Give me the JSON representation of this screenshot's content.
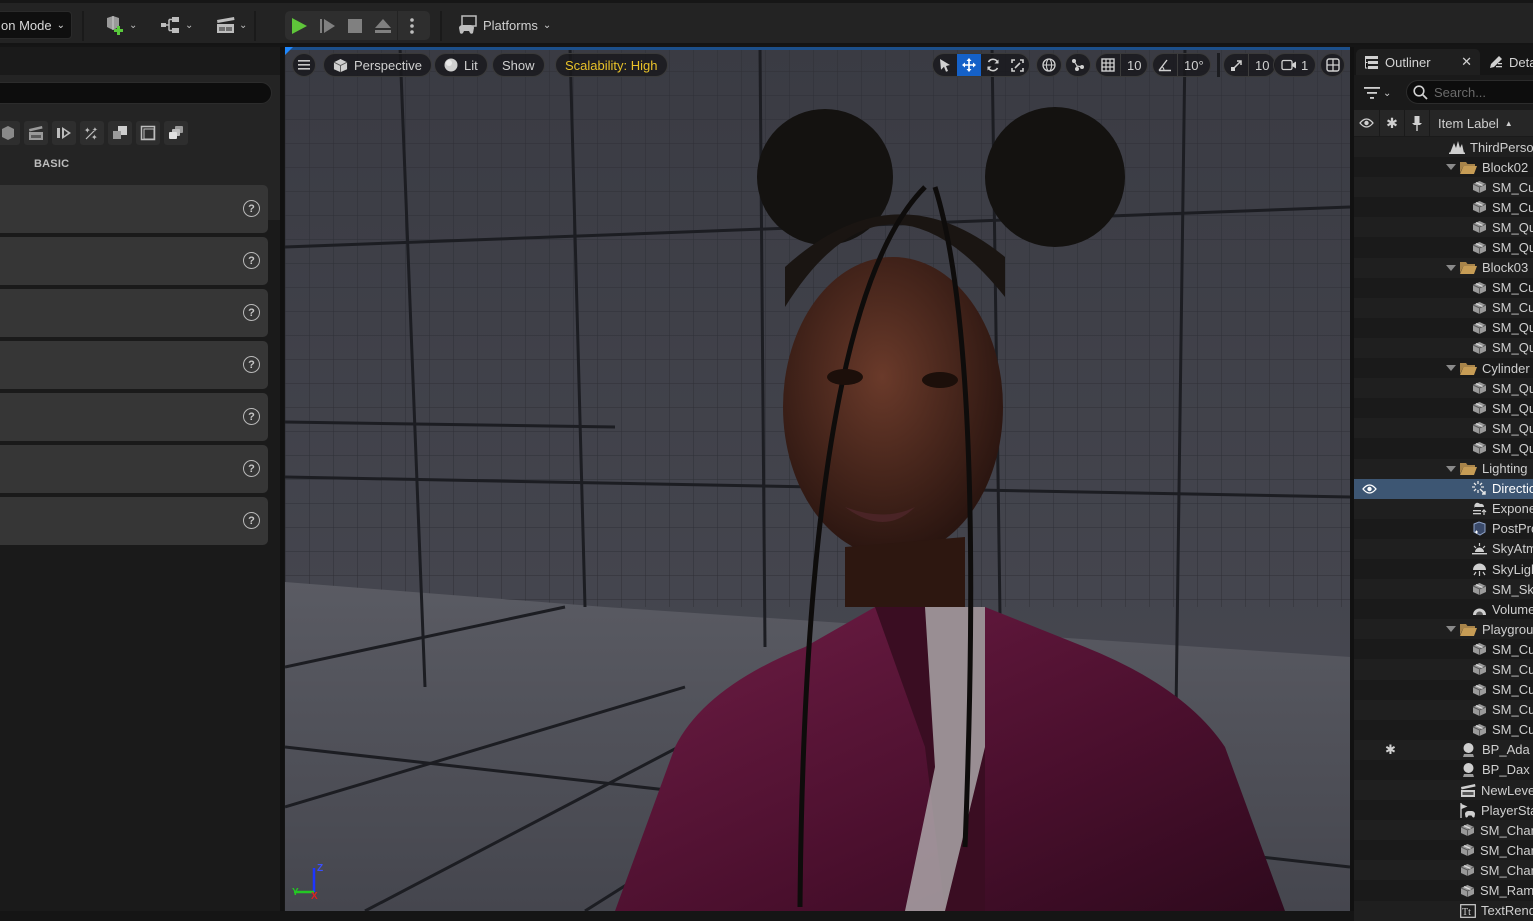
{
  "toolbar": {
    "mode_label": "on Mode",
    "icons": [
      "add-actor-icon",
      "blueprint-icon",
      "cinematics-icon"
    ],
    "play_controls": [
      "play-icon",
      "advance-frame-icon",
      "stop-icon",
      "eject-icon",
      "more-options-icon"
    ],
    "platforms_label": "Platforms"
  },
  "left_panel": {
    "search_placeholder": "",
    "category_label": "BASIC",
    "category_icons": [
      "shape-icon",
      "cinematic-icon",
      "visual-effects-icon",
      "volumes-icon",
      "geometry-icon",
      "all-classes-icon",
      "recent-icon"
    ],
    "items_count": 7
  },
  "viewport": {
    "menu_icon": "hamburger-icon",
    "view_mode": "Perspective",
    "lighting_mode": "Lit",
    "show_label": "Show",
    "scalability_label": "Scalability: High",
    "grid_snap": "10",
    "rotation_snap": "10°",
    "scale_snap": "10",
    "camera_speed": "1",
    "active_transform": "translate",
    "colors": {
      "accent": "#1561c8",
      "scalability": "#e9c229"
    },
    "axis_labels": {
      "x": "X",
      "y": "Y",
      "z": "Z"
    }
  },
  "outliner": {
    "tab_label": "Outliner",
    "details_tab_label": "Details",
    "search_placeholder": "Search...",
    "column_label": "Item Label",
    "rows": [
      {
        "label": "ThirdPersonMap",
        "indent": 0,
        "icon": "level-icon"
      },
      {
        "label": "Block02",
        "indent": 1,
        "icon": "folder-icon",
        "folder": true
      },
      {
        "label": "SM_Cube",
        "indent": 2,
        "icon": "static-mesh-icon"
      },
      {
        "label": "SM_Cube",
        "indent": 2,
        "icon": "static-mesh-icon"
      },
      {
        "label": "SM_QuarterCylinder",
        "indent": 2,
        "icon": "static-mesh-icon"
      },
      {
        "label": "SM_QuarterCylinder",
        "indent": 2,
        "icon": "static-mesh-icon"
      },
      {
        "label": "Block03",
        "indent": 1,
        "icon": "folder-icon",
        "folder": true
      },
      {
        "label": "SM_Cube",
        "indent": 2,
        "icon": "static-mesh-icon"
      },
      {
        "label": "SM_Cube",
        "indent": 2,
        "icon": "static-mesh-icon"
      },
      {
        "label": "SM_QuarterCylinder",
        "indent": 2,
        "icon": "static-mesh-icon"
      },
      {
        "label": "SM_QuarterCylinder",
        "indent": 2,
        "icon": "static-mesh-icon"
      },
      {
        "label": "Cylinder",
        "indent": 1,
        "icon": "folder-icon",
        "folder": true
      },
      {
        "label": "SM_QuarterCylinder",
        "indent": 2,
        "icon": "static-mesh-icon"
      },
      {
        "label": "SM_QuarterCylinder",
        "indent": 2,
        "icon": "static-mesh-icon"
      },
      {
        "label": "SM_QuarterCylinder",
        "indent": 2,
        "icon": "static-mesh-icon"
      },
      {
        "label": "SM_QuarterCylinder",
        "indent": 2,
        "icon": "static-mesh-icon"
      },
      {
        "label": "Lighting",
        "indent": 1,
        "icon": "folder-icon",
        "folder": true
      },
      {
        "label": "DirectionalLight",
        "indent": 2,
        "icon": "directional-light-icon",
        "selected": true,
        "visible_eye": true
      },
      {
        "label": "ExponentialHeightFog",
        "indent": 2,
        "icon": "fog-icon"
      },
      {
        "label": "PostProcessVolume",
        "indent": 2,
        "icon": "post-process-icon"
      },
      {
        "label": "SkyAtmosphere",
        "indent": 2,
        "icon": "sky-atmosphere-icon"
      },
      {
        "label": "SkyLight",
        "indent": 2,
        "icon": "sky-light-icon"
      },
      {
        "label": "SM_SkySphere",
        "indent": 2,
        "icon": "static-mesh-icon"
      },
      {
        "label": "VolumetricCloud",
        "indent": 2,
        "icon": "volumetric-cloud-icon"
      },
      {
        "label": "PlaygroundArea",
        "indent": 1,
        "icon": "folder-icon",
        "folder": true
      },
      {
        "label": "SM_Cube",
        "indent": 2,
        "icon": "static-mesh-icon"
      },
      {
        "label": "SM_Cube",
        "indent": 2,
        "icon": "static-mesh-icon"
      },
      {
        "label": "SM_Cube",
        "indent": 2,
        "icon": "static-mesh-icon"
      },
      {
        "label": "SM_Cube",
        "indent": 2,
        "icon": "static-mesh-icon"
      },
      {
        "label": "SM_Cube",
        "indent": 2,
        "icon": "static-mesh-icon"
      },
      {
        "label": "BP_Ada",
        "indent": 1,
        "icon": "character-icon",
        "starred": true
      },
      {
        "label": "BP_Dax",
        "indent": 1,
        "icon": "character-icon"
      },
      {
        "label": "NewLevelSequence",
        "indent": 1,
        "icon": "level-sequence-icon"
      },
      {
        "label": "PlayerStart",
        "indent": 1,
        "icon": "player-start-icon"
      },
      {
        "label": "SM_ChamferCube",
        "indent": 1,
        "icon": "static-mesh-icon"
      },
      {
        "label": "SM_ChamferCube",
        "indent": 1,
        "icon": "static-mesh-icon"
      },
      {
        "label": "SM_ChamferCube",
        "indent": 1,
        "icon": "static-mesh-icon"
      },
      {
        "label": "SM_Ramp",
        "indent": 1,
        "icon": "static-mesh-icon"
      },
      {
        "label": "TextRenderActor",
        "indent": 1,
        "icon": "text-render-icon"
      }
    ]
  }
}
